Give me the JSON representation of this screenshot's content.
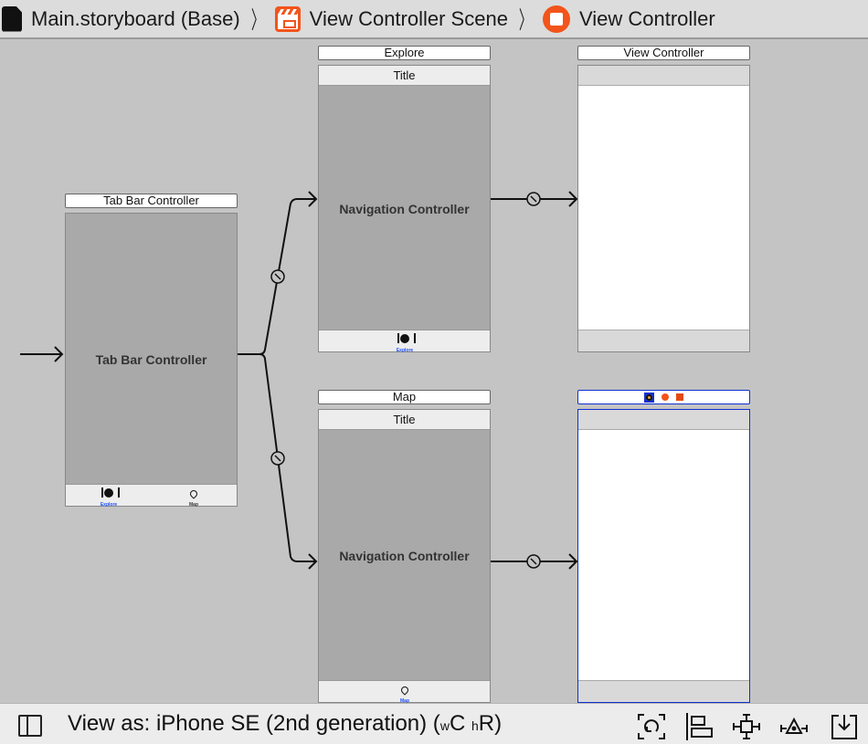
{
  "breadcrumb": {
    "items": [
      {
        "label": "Main.storyboard (Base)",
        "icon": "storyboard-file-icon"
      },
      {
        "label": "View Controller Scene",
        "icon": "scene-icon"
      },
      {
        "label": "View Controller",
        "icon": "view-controller-icon"
      }
    ],
    "separator": "〉"
  },
  "scenes": {
    "tab_bar_controller": {
      "title": "Tab Bar Controller",
      "label": "Tab Bar Controller",
      "tabs": [
        {
          "label": "Explore",
          "icon": "fork-knife-icon",
          "selected": true
        },
        {
          "label": "Map",
          "icon": "map-pin-icon",
          "selected": false
        }
      ]
    },
    "nav_explore": {
      "title": "Explore",
      "nav_title": "Title",
      "label": "Navigation Controller",
      "tab": {
        "label": "Explore",
        "icon": "fork-knife-icon"
      }
    },
    "vc_explore": {
      "title": "View Controller"
    },
    "nav_map": {
      "title": "Map",
      "nav_title": "Title",
      "label": "Navigation Controller",
      "tab": {
        "label": "Map",
        "icon": "map-pin-icon"
      }
    },
    "vc_map": {
      "title": "",
      "selected": true,
      "dock_icons": [
        "view-controller-icon",
        "first-responder-icon",
        "exit-icon"
      ]
    }
  },
  "colors": {
    "accent": "#f2541b",
    "selection": "#1030d0",
    "tab_selected": "#1b4fff",
    "canvas": "#c4c4c4"
  },
  "bottombar": {
    "view_as_prefix": "View as: iPhone SE (2nd generation) (",
    "w_class": "w",
    "w_value": "C",
    "h_class": "h",
    "h_value": "R",
    "suffix": ")",
    "tools": [
      "update-frames-icon",
      "align-icon",
      "add-constraints-icon",
      "resolve-issues-icon",
      "embed-in-icon"
    ]
  }
}
